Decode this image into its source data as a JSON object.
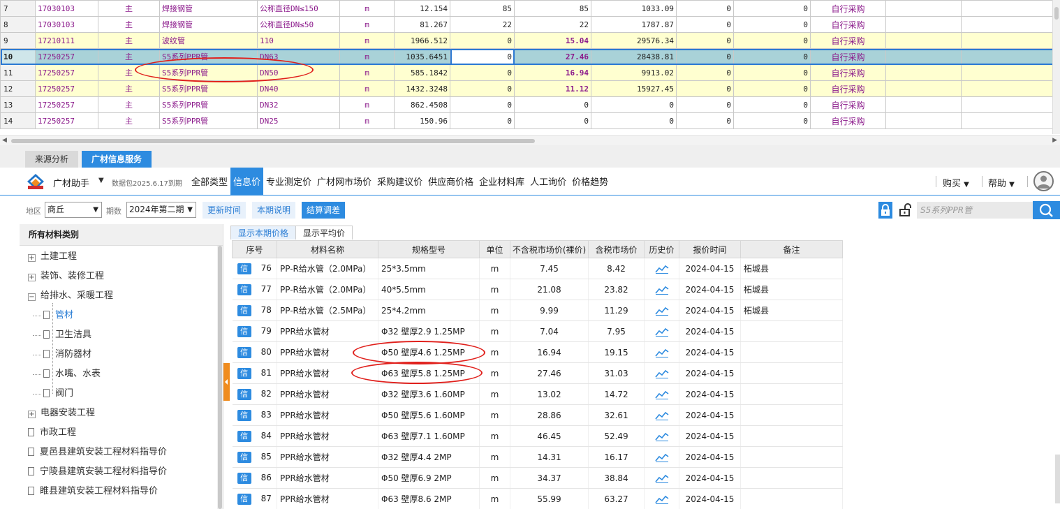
{
  "top_grid": {
    "rows": [
      {
        "rn": "7",
        "code": "17030103",
        "type": "主",
        "name": "焊接钢管",
        "spec": "公称直径DN≤150",
        "unit": "m",
        "qty": "12.154",
        "c1": "85",
        "price": "85",
        "total": "1033.09",
        "c2": "0",
        "c3": "0",
        "source": "自行采购",
        "style": "normal"
      },
      {
        "rn": "8",
        "code": "17030103",
        "type": "主",
        "name": "焊接钢管",
        "spec": "公称直径DN≤50",
        "unit": "m",
        "qty": "81.267",
        "c1": "22",
        "price": "22",
        "total": "1787.87",
        "c2": "0",
        "c3": "0",
        "source": "自行采购",
        "style": "normal"
      },
      {
        "rn": "9",
        "code": "17210111",
        "type": "主",
        "name": "波纹管",
        "spec": "110",
        "unit": "m",
        "qty": "1966.512",
        "c1": "0",
        "price": "15.04",
        "total": "29576.34",
        "c2": "0",
        "c3": "0",
        "source": "自行采购",
        "style": "yellow"
      },
      {
        "rn": "10",
        "code": "17250257",
        "type": "主",
        "name": "S5系列PPR管",
        "spec": "DN63",
        "unit": "m",
        "qty": "1035.6451",
        "c1": "0",
        "price": "27.46",
        "total": "28438.81",
        "c2": "0",
        "c3": "0",
        "source": "自行采购",
        "style": "selected"
      },
      {
        "rn": "11",
        "code": "17250257",
        "type": "主",
        "name": "S5系列PPR管",
        "spec": "DN50",
        "unit": "m",
        "qty": "585.1842",
        "c1": "0",
        "price": "16.94",
        "total": "9913.02",
        "c2": "0",
        "c3": "0",
        "source": "自行采购",
        "style": "yellow"
      },
      {
        "rn": "12",
        "code": "17250257",
        "type": "主",
        "name": "S5系列PPR管",
        "spec": "DN40",
        "unit": "m",
        "qty": "1432.3248",
        "c1": "0",
        "price": "11.12",
        "total": "15927.45",
        "c2": "0",
        "c3": "0",
        "source": "自行采购",
        "style": "yellow"
      },
      {
        "rn": "13",
        "code": "17250257",
        "type": "主",
        "name": "S5系列PPR管",
        "spec": "DN32",
        "unit": "m",
        "qty": "862.4508",
        "c1": "0",
        "price": "0",
        "total": "0",
        "c2": "0",
        "c3": "0",
        "source": "自行采购",
        "style": "normal"
      },
      {
        "rn": "14",
        "code": "17250257",
        "type": "主",
        "name": "S5系列PPR管",
        "spec": "DN25",
        "unit": "m",
        "qty": "150.96",
        "c1": "0",
        "price": "0",
        "total": "0",
        "c2": "0",
        "c3": "0",
        "source": "自行采购",
        "style": "normal"
      }
    ]
  },
  "panel_tabs": {
    "source_analysis": "来源分析",
    "gc_info": "广材信息服务"
  },
  "navbar": {
    "brand": "广材助手",
    "expiry": "数据包2025.6.17到期",
    "links": [
      "全部类型",
      "信息价",
      "专业测定价",
      "广材网市场价",
      "采购建议价",
      "供应商价格",
      "企业材料库",
      "人工询价",
      "价格趋势"
    ],
    "active_index": 1,
    "buy": "购买",
    "help": "帮助"
  },
  "filter": {
    "region_label": "地区",
    "region_value": "商丘",
    "period_label": "期数",
    "period_value": "2024年第二期",
    "update_time": "更新时间",
    "period_note": "本期说明",
    "settle_diff": "结算调差",
    "search_placeholder": "S5系列PPR管"
  },
  "sidebar": {
    "title": "所有材料类别",
    "items": [
      {
        "label": "土建工程",
        "kind": "plus"
      },
      {
        "label": "装饰、装修工程",
        "kind": "plus"
      },
      {
        "label": "给排水、采暖工程",
        "kind": "minus"
      },
      {
        "label": "管材",
        "kind": "child-selected"
      },
      {
        "label": "卫生洁具",
        "kind": "child"
      },
      {
        "label": "消防器材",
        "kind": "child"
      },
      {
        "label": "水嘴、水表",
        "kind": "child"
      },
      {
        "label": "阀门",
        "kind": "child"
      },
      {
        "label": "电器安装工程",
        "kind": "plus"
      },
      {
        "label": "市政工程",
        "kind": "doc"
      },
      {
        "label": "夏邑县建筑安装工程材料指导价",
        "kind": "doc"
      },
      {
        "label": "宁陵县建筑安装工程材料指导价",
        "kind": "doc"
      },
      {
        "label": "睢县建筑安装工程材料指导价",
        "kind": "doc"
      }
    ]
  },
  "price_panel": {
    "subtab_current": "显示本期价格",
    "subtab_avg": "显示平均价",
    "columns": [
      "序号",
      "材料名称",
      "规格型号",
      "单位",
      "不含税市场价(裸价)",
      "含税市场价",
      "历史价",
      "报价时间",
      "备注"
    ],
    "badge": "信",
    "rows": [
      {
        "no": "76",
        "name": "PP-R给水管（2.0MPa）",
        "spec": "25*3.5mm",
        "unit": "m",
        "pre_tax": "7.45",
        "tax": "8.42",
        "date": "2024-04-15",
        "note": "柘城县"
      },
      {
        "no": "77",
        "name": "PP-R给水管（2.0MPa）",
        "spec": "40*5.5mm",
        "unit": "m",
        "pre_tax": "21.08",
        "tax": "23.82",
        "date": "2024-04-15",
        "note": "柘城县"
      },
      {
        "no": "78",
        "name": "PP-R给水管（2.5MPa）",
        "spec": "25*4.2mm",
        "unit": "m",
        "pre_tax": "9.99",
        "tax": "11.29",
        "date": "2024-04-15",
        "note": "柘城县"
      },
      {
        "no": "79",
        "name": "PPR给水管材",
        "spec": "Φ32 壁厚2.9 1.25MP",
        "unit": "m",
        "pre_tax": "7.04",
        "tax": "7.95",
        "date": "2024-04-15",
        "note": ""
      },
      {
        "no": "80",
        "name": "PPR给水管材",
        "spec": "Φ50 壁厚4.6 1.25MP",
        "unit": "m",
        "pre_tax": "16.94",
        "tax": "19.15",
        "date": "2024-04-15",
        "note": ""
      },
      {
        "no": "81",
        "name": "PPR给水管材",
        "spec": "Φ63 壁厚5.8 1.25MP",
        "unit": "m",
        "pre_tax": "27.46",
        "tax": "31.03",
        "date": "2024-04-15",
        "note": ""
      },
      {
        "no": "82",
        "name": "PPR给水管材",
        "spec": "Φ32 壁厚3.6 1.60MP",
        "unit": "m",
        "pre_tax": "13.02",
        "tax": "14.72",
        "date": "2024-04-15",
        "note": ""
      },
      {
        "no": "83",
        "name": "PPR给水管材",
        "spec": "Φ50 壁厚5.6 1.60MP",
        "unit": "m",
        "pre_tax": "28.86",
        "tax": "32.61",
        "date": "2024-04-15",
        "note": ""
      },
      {
        "no": "84",
        "name": "PPR给水管材",
        "spec": "Φ63 壁厚7.1 1.60MP",
        "unit": "m",
        "pre_tax": "46.45",
        "tax": "52.49",
        "date": "2024-04-15",
        "note": ""
      },
      {
        "no": "85",
        "name": "PPR给水管材",
        "spec": "Φ32 壁厚4.4 2MP",
        "unit": "m",
        "pre_tax": "14.31",
        "tax": "16.17",
        "date": "2024-04-15",
        "note": ""
      },
      {
        "no": "86",
        "name": "PPR给水管材",
        "spec": "Φ50 壁厚6.9 2MP",
        "unit": "m",
        "pre_tax": "34.37",
        "tax": "38.84",
        "date": "2024-04-15",
        "note": ""
      },
      {
        "no": "87",
        "name": "PPR给水管材",
        "spec": "Φ63 壁厚8.6 2MP",
        "unit": "m",
        "pre_tax": "55.99",
        "tax": "63.27",
        "date": "2024-04-15",
        "note": ""
      }
    ]
  },
  "colors": {
    "accent": "#2d8be0",
    "highlight_row": "#ffffd0",
    "selected_row": "#a9d2d8",
    "purple_text": "#8b1a8b",
    "annotation": "#e0201c",
    "handle": "#f08c1e"
  },
  "icons": {
    "logo": "gc-logo-icon",
    "trend": "trend-chart-icon",
    "lock": "lock-icon",
    "unlock": "unlock-icon",
    "search": "search-icon",
    "avatar": "user-avatar-icon"
  }
}
